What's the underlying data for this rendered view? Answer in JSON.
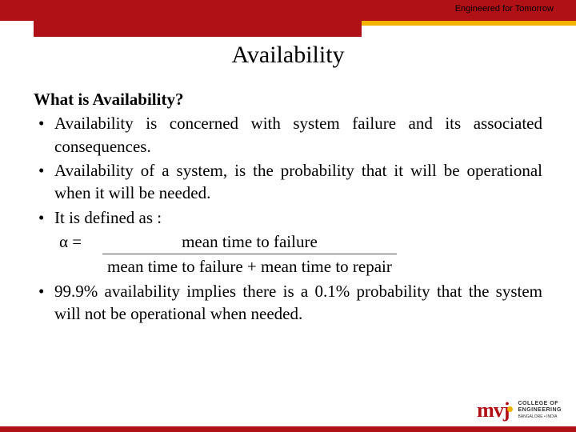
{
  "header": {
    "tagline": "Engineered for Tomorrow"
  },
  "title": "Availability",
  "content": {
    "subhead": "What is Availability?",
    "bullets": [
      "Availability is concerned with system failure and its associated consequences.",
      "Availability of a system, is the probability that it will be operational when it will be needed.",
      "It is defined as :",
      "99.9% availability implies there is a 0.1% probability that the system will not be operational when needed."
    ],
    "formula": {
      "lhs": "α  =",
      "numerator": "mean time to failure",
      "denominator": "mean time to failure + mean time to repair"
    }
  },
  "footer": {
    "logo_mark": "mvj",
    "logo_line1": "COLLEGE OF",
    "logo_line2": "ENGINEERING",
    "logo_sub": "BANGALORE • INDIA"
  }
}
